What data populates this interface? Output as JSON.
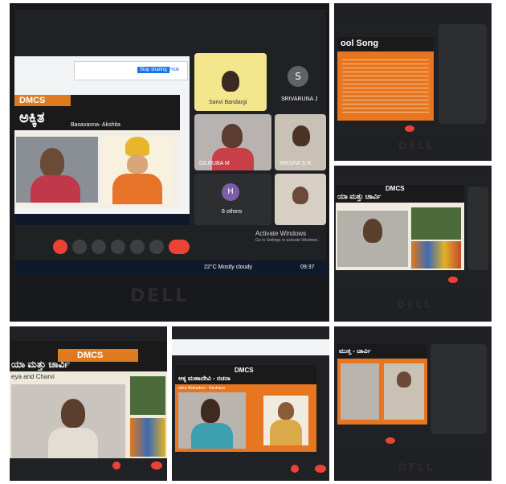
{
  "collage": {
    "photo1": {
      "logo": "DMCS",
      "slide_title": "ಅಕ್ಕಿತ",
      "slide_subtitle": "Basavanna- Akshita",
      "participants": [
        {
          "label": "Sanvi Bandargi"
        },
        {
          "label": "SRIVARUNA J"
        },
        {
          "label": "DILRUBA M"
        },
        {
          "label": "RIKSHA S R"
        },
        {
          "label": "8 others",
          "avatar": "H"
        }
      ],
      "srivaruna_avatar": "S",
      "activate_windows": "Activate Windows",
      "activate_sub": "Go to Settings to activate Windows.",
      "weather": "22°C  Mostly cloudy",
      "clock": "09:37",
      "browser_popup": {
        "stop": "Stop sharing",
        "hide": "Hide"
      },
      "brand": "DELL"
    },
    "photo2": {
      "slide_title": "ool Song",
      "brand": "DELL"
    },
    "photo3": {
      "logo": "DMCS",
      "slide_title": "ಯಾ ಮತ್ತು ಚಾರ್ವಿ",
      "brand": "DELL"
    },
    "photo4": {
      "logo": "DMCS",
      "slide_title": "ಯಾ ಮತ್ತು ಚಾರ್ವಿ",
      "slide_subtitle": "eya and Charvi"
    },
    "photo5": {
      "logo": "DMCS",
      "slide_title": "ಅಕ್ಕ ಮಹಾದೇವಿ - ರಚನಾ",
      "slide_subtitle": "akka Mahadevi - Rachana"
    },
    "photo6": {
      "slide_title": "ಮುತ್ತ - ಚಾರ್ವಿ",
      "brand": "DELL"
    }
  }
}
